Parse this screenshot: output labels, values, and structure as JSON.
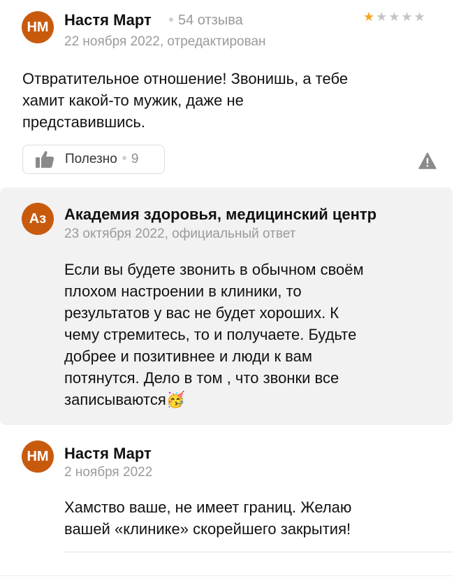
{
  "colors": {
    "avatar": "#c85a0e",
    "star_active": "#f5a623",
    "star_inactive": "#c4c4c4",
    "reply_bg": "#f2f2f2"
  },
  "review": {
    "avatar_initials": "НМ",
    "author": "Настя Март",
    "review_count": "54 отзыва",
    "date": "22 ноября 2022, отредактирован",
    "rating": 1,
    "rating_max": 5,
    "text": "Отвратительное отношение! Звонишь, а тебе\nхамит какой-то мужик, даже не\nпредставившись.",
    "useful_label": "Полезно",
    "useful_count": "9",
    "thumb_icon": "thumbs-up-icon",
    "report_icon": "warning-icon"
  },
  "reply": {
    "avatar_initials": "Аз",
    "author": "Академия здоровья, медицинский центр",
    "date": "23 октября 2022, официальный ответ",
    "text": "Если вы будете звонить в обычном своём\nплохом настроении в клиники, то\nрезультатов у вас не будет хороших. К\nчему стремитесь, то и получаете. Будьте\nдобрее и позитивнее и люди к вам\nпотянутся. Дело в том , что звонки все\nзаписываются🥳"
  },
  "comment": {
    "avatar_initials": "НМ",
    "author": "Настя Март",
    "date": "2 ноября 2022",
    "text": "Хамство ваше, не имеет границ. Желаю\nвашей «клинике» скорейшего закрытия!"
  }
}
